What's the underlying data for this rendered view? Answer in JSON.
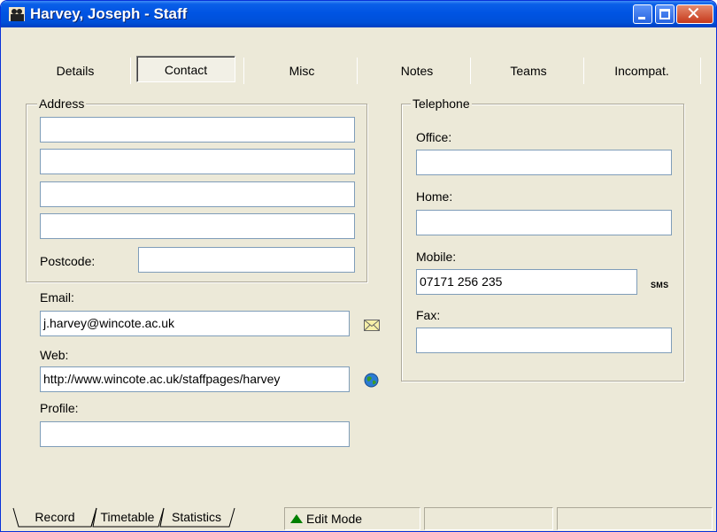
{
  "window": {
    "title": "Harvey, Joseph - Staff"
  },
  "tabs": [
    {
      "label": "Details"
    },
    {
      "label": "Contact"
    },
    {
      "label": "Misc"
    },
    {
      "label": "Notes"
    },
    {
      "label": "Teams"
    },
    {
      "label": "Incompat."
    }
  ],
  "address": {
    "legend": "Address",
    "line1": "",
    "line2": "",
    "line3": "",
    "line4": "",
    "postcode_label": "Postcode:",
    "postcode": ""
  },
  "email": {
    "label": "Email:",
    "value": "j.harvey@wincote.ac.uk"
  },
  "web": {
    "label": "Web:",
    "value": "http://www.wincote.ac.uk/staffpages/harvey"
  },
  "profile": {
    "label": "Profile:",
    "value": ""
  },
  "telephone": {
    "legend": "Telephone",
    "office_label": "Office:",
    "office": "",
    "home_label": "Home:",
    "home": "",
    "mobile_label": "Mobile:",
    "mobile": "07171 256 235",
    "sms_label": "SMS",
    "fax_label": "Fax:",
    "fax": ""
  },
  "bottom_tabs": [
    {
      "label": "Record"
    },
    {
      "label": "Timetable"
    },
    {
      "label": "Statistics"
    }
  ],
  "status": {
    "mode": "Edit Mode"
  },
  "colors": {
    "titlebar": "#0054e3",
    "face": "#ece9d8",
    "edit_mode": "#008000"
  }
}
